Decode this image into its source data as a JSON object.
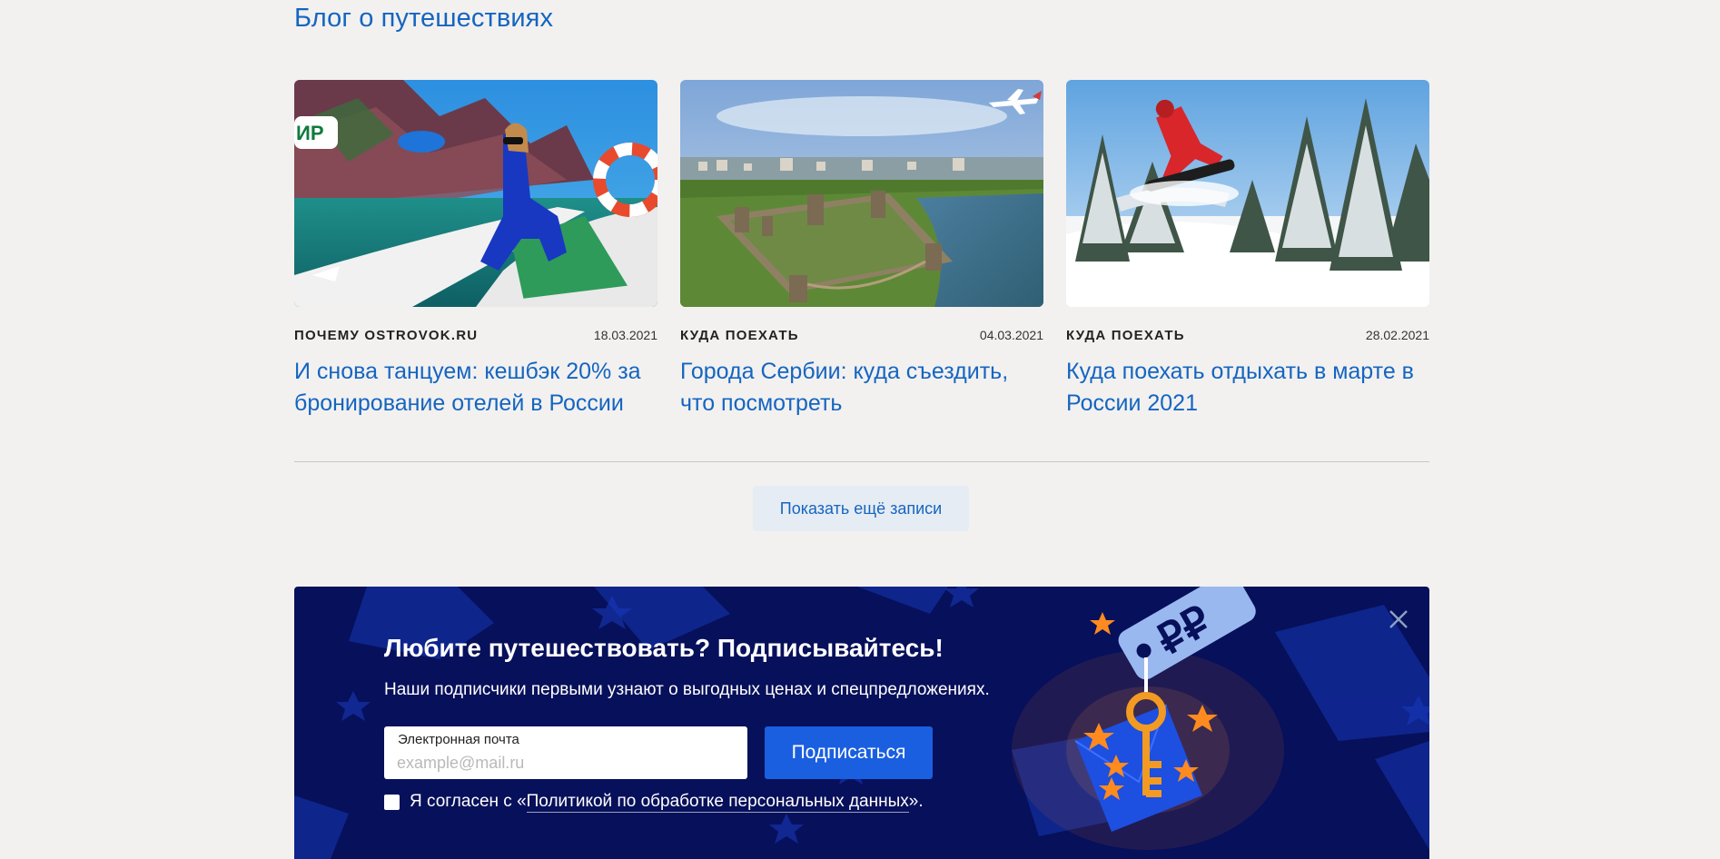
{
  "blog": {
    "title": "Блог о путешествиях",
    "cards": [
      {
        "category": "ПОЧЕМУ OSTROVOK.RU",
        "date": "18.03.2021",
        "title": "И снова танцуем: кешбэк 20% за бронирование отелей в России",
        "badge": "ИР"
      },
      {
        "category": "КУДА ПОЕХАТЬ",
        "date": "04.03.2021",
        "title": "Города Сербии: куда съездить, что посмотреть"
      },
      {
        "category": "КУДА ПОЕХАТЬ",
        "date": "28.02.2021",
        "title": "Куда поехать отдыхать в марте в России 2021"
      }
    ],
    "more_label": "Показать ещё записи"
  },
  "subscribe": {
    "title": "Любите путешествовать? Подписывайтесь!",
    "text": "Наши подписчики первыми узнают о выгодных ценах и спецпредложениях.",
    "email_label": "Электронная почта",
    "email_placeholder": "example@mail.ru",
    "email_value": "",
    "button_label": "Подписаться",
    "agree_prefix": "Я согласен с «",
    "agree_link": "Политикой по обработке персональных данных",
    "agree_suffix": "».",
    "checkbox_checked": false,
    "tag_symbol": "₽₽"
  },
  "colors": {
    "page_bg": "#f2f1f0",
    "link_blue": "#1565c0",
    "banner_bg": "#07105a",
    "button_blue": "#1a5fe0",
    "accent_orange": "#ff8a1f"
  },
  "icons": [
    "close-icon",
    "checkbox-icon",
    "key-icon",
    "envelope-icon",
    "star-icon",
    "price-tag-icon",
    "airplane-icon"
  ]
}
